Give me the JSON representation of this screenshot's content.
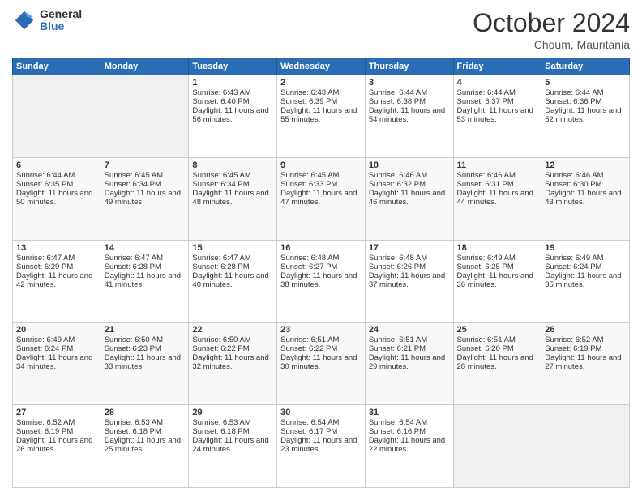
{
  "header": {
    "logo_general": "General",
    "logo_blue": "Blue",
    "month_title": "October 2024",
    "location": "Choum, Mauritania"
  },
  "weekdays": [
    "Sunday",
    "Monday",
    "Tuesday",
    "Wednesday",
    "Thursday",
    "Friday",
    "Saturday"
  ],
  "weeks": [
    [
      {
        "day": "",
        "sunrise": "",
        "sunset": "",
        "daylight": ""
      },
      {
        "day": "",
        "sunrise": "",
        "sunset": "",
        "daylight": ""
      },
      {
        "day": "1",
        "sunrise": "Sunrise: 6:43 AM",
        "sunset": "Sunset: 6:40 PM",
        "daylight": "Daylight: 11 hours and 56 minutes."
      },
      {
        "day": "2",
        "sunrise": "Sunrise: 6:43 AM",
        "sunset": "Sunset: 6:39 PM",
        "daylight": "Daylight: 11 hours and 55 minutes."
      },
      {
        "day": "3",
        "sunrise": "Sunrise: 6:44 AM",
        "sunset": "Sunset: 6:38 PM",
        "daylight": "Daylight: 11 hours and 54 minutes."
      },
      {
        "day": "4",
        "sunrise": "Sunrise: 6:44 AM",
        "sunset": "Sunset: 6:37 PM",
        "daylight": "Daylight: 11 hours and 53 minutes."
      },
      {
        "day": "5",
        "sunrise": "Sunrise: 6:44 AM",
        "sunset": "Sunset: 6:36 PM",
        "daylight": "Daylight: 11 hours and 52 minutes."
      }
    ],
    [
      {
        "day": "6",
        "sunrise": "Sunrise: 6:44 AM",
        "sunset": "Sunset: 6:35 PM",
        "daylight": "Daylight: 11 hours and 50 minutes."
      },
      {
        "day": "7",
        "sunrise": "Sunrise: 6:45 AM",
        "sunset": "Sunset: 6:34 PM",
        "daylight": "Daylight: 11 hours and 49 minutes."
      },
      {
        "day": "8",
        "sunrise": "Sunrise: 6:45 AM",
        "sunset": "Sunset: 6:34 PM",
        "daylight": "Daylight: 11 hours and 48 minutes."
      },
      {
        "day": "9",
        "sunrise": "Sunrise: 6:45 AM",
        "sunset": "Sunset: 6:33 PM",
        "daylight": "Daylight: 11 hours and 47 minutes."
      },
      {
        "day": "10",
        "sunrise": "Sunrise: 6:46 AM",
        "sunset": "Sunset: 6:32 PM",
        "daylight": "Daylight: 11 hours and 46 minutes."
      },
      {
        "day": "11",
        "sunrise": "Sunrise: 6:46 AM",
        "sunset": "Sunset: 6:31 PM",
        "daylight": "Daylight: 11 hours and 44 minutes."
      },
      {
        "day": "12",
        "sunrise": "Sunrise: 6:46 AM",
        "sunset": "Sunset: 6:30 PM",
        "daylight": "Daylight: 11 hours and 43 minutes."
      }
    ],
    [
      {
        "day": "13",
        "sunrise": "Sunrise: 6:47 AM",
        "sunset": "Sunset: 6:29 PM",
        "daylight": "Daylight: 11 hours and 42 minutes."
      },
      {
        "day": "14",
        "sunrise": "Sunrise: 6:47 AM",
        "sunset": "Sunset: 6:28 PM",
        "daylight": "Daylight: 11 hours and 41 minutes."
      },
      {
        "day": "15",
        "sunrise": "Sunrise: 6:47 AM",
        "sunset": "Sunset: 6:28 PM",
        "daylight": "Daylight: 11 hours and 40 minutes."
      },
      {
        "day": "16",
        "sunrise": "Sunrise: 6:48 AM",
        "sunset": "Sunset: 6:27 PM",
        "daylight": "Daylight: 11 hours and 38 minutes."
      },
      {
        "day": "17",
        "sunrise": "Sunrise: 6:48 AM",
        "sunset": "Sunset: 6:26 PM",
        "daylight": "Daylight: 11 hours and 37 minutes."
      },
      {
        "day": "18",
        "sunrise": "Sunrise: 6:49 AM",
        "sunset": "Sunset: 6:25 PM",
        "daylight": "Daylight: 11 hours and 36 minutes."
      },
      {
        "day": "19",
        "sunrise": "Sunrise: 6:49 AM",
        "sunset": "Sunset: 6:24 PM",
        "daylight": "Daylight: 11 hours and 35 minutes."
      }
    ],
    [
      {
        "day": "20",
        "sunrise": "Sunrise: 6:49 AM",
        "sunset": "Sunset: 6:24 PM",
        "daylight": "Daylight: 11 hours and 34 minutes."
      },
      {
        "day": "21",
        "sunrise": "Sunrise: 6:50 AM",
        "sunset": "Sunset: 6:23 PM",
        "daylight": "Daylight: 11 hours and 33 minutes."
      },
      {
        "day": "22",
        "sunrise": "Sunrise: 6:50 AM",
        "sunset": "Sunset: 6:22 PM",
        "daylight": "Daylight: 11 hours and 32 minutes."
      },
      {
        "day": "23",
        "sunrise": "Sunrise: 6:51 AM",
        "sunset": "Sunset: 6:22 PM",
        "daylight": "Daylight: 11 hours and 30 minutes."
      },
      {
        "day": "24",
        "sunrise": "Sunrise: 6:51 AM",
        "sunset": "Sunset: 6:21 PM",
        "daylight": "Daylight: 11 hours and 29 minutes."
      },
      {
        "day": "25",
        "sunrise": "Sunrise: 6:51 AM",
        "sunset": "Sunset: 6:20 PM",
        "daylight": "Daylight: 11 hours and 28 minutes."
      },
      {
        "day": "26",
        "sunrise": "Sunrise: 6:52 AM",
        "sunset": "Sunset: 6:19 PM",
        "daylight": "Daylight: 11 hours and 27 minutes."
      }
    ],
    [
      {
        "day": "27",
        "sunrise": "Sunrise: 6:52 AM",
        "sunset": "Sunset: 6:19 PM",
        "daylight": "Daylight: 11 hours and 26 minutes."
      },
      {
        "day": "28",
        "sunrise": "Sunrise: 6:53 AM",
        "sunset": "Sunset: 6:18 PM",
        "daylight": "Daylight: 11 hours and 25 minutes."
      },
      {
        "day": "29",
        "sunrise": "Sunrise: 6:53 AM",
        "sunset": "Sunset: 6:18 PM",
        "daylight": "Daylight: 11 hours and 24 minutes."
      },
      {
        "day": "30",
        "sunrise": "Sunrise: 6:54 AM",
        "sunset": "Sunset: 6:17 PM",
        "daylight": "Daylight: 11 hours and 23 minutes."
      },
      {
        "day": "31",
        "sunrise": "Sunrise: 6:54 AM",
        "sunset": "Sunset: 6:16 PM",
        "daylight": "Daylight: 11 hours and 22 minutes."
      },
      {
        "day": "",
        "sunrise": "",
        "sunset": "",
        "daylight": ""
      },
      {
        "day": "",
        "sunrise": "",
        "sunset": "",
        "daylight": ""
      }
    ]
  ]
}
